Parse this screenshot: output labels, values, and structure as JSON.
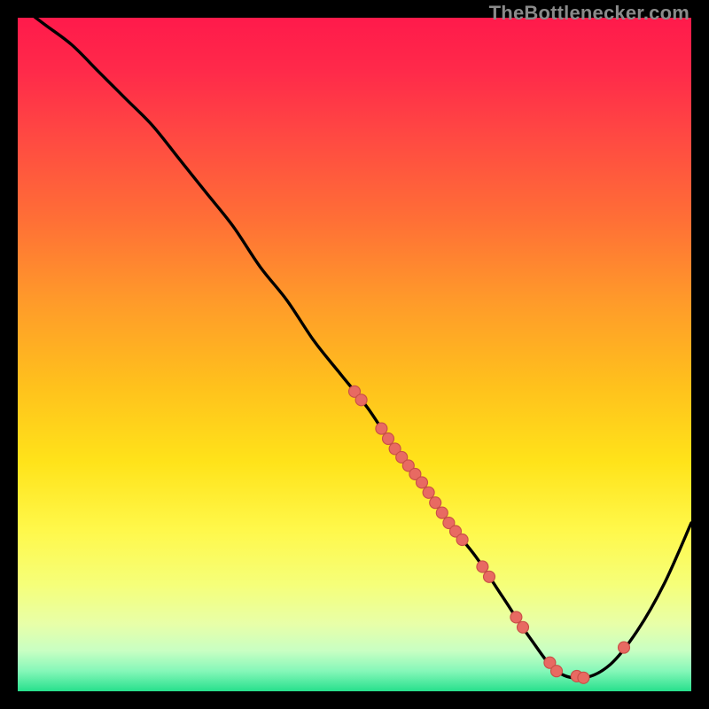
{
  "watermark": "TheBottlenecker.com",
  "gradient_stops": [
    {
      "offset": 0.0,
      "color": "#ff1a4b"
    },
    {
      "offset": 0.08,
      "color": "#ff2a4a"
    },
    {
      "offset": 0.18,
      "color": "#ff4a42"
    },
    {
      "offset": 0.3,
      "color": "#ff6f36"
    },
    {
      "offset": 0.42,
      "color": "#ff9a2a"
    },
    {
      "offset": 0.55,
      "color": "#ffc21c"
    },
    {
      "offset": 0.66,
      "color": "#ffe31a"
    },
    {
      "offset": 0.76,
      "color": "#fff84a"
    },
    {
      "offset": 0.84,
      "color": "#f6ff78"
    },
    {
      "offset": 0.9,
      "color": "#e8ffa8"
    },
    {
      "offset": 0.94,
      "color": "#c8ffc3"
    },
    {
      "offset": 0.97,
      "color": "#85f7b9"
    },
    {
      "offset": 1.0,
      "color": "#27e08c"
    }
  ],
  "curve_color": "#000000",
  "dot_fill": "#e86a62",
  "dot_stroke": "#c94f47",
  "chart_data": {
    "type": "line",
    "title": "",
    "xlabel": "",
    "ylabel": "",
    "xlim": [
      0,
      100
    ],
    "ylim": [
      0,
      100
    ],
    "description": "Bottleneck / fit curve on vertical rainbow gradient (red high → green low). Lower y = better match. Minimum near x≈80.",
    "series": [
      {
        "name": "curve",
        "x": [
          0,
          4,
          8,
          12,
          16,
          20,
          24,
          28,
          32,
          36,
          40,
          44,
          48,
          52,
          56,
          60,
          64,
          68,
          72,
          76,
          80,
          84,
          88,
          92,
          96,
          100
        ],
        "y": [
          102,
          99,
          96,
          92,
          88,
          84,
          79,
          74,
          69,
          63,
          58,
          52,
          47,
          42,
          36,
          31,
          25,
          20,
          14,
          8,
          3,
          2,
          4,
          9,
          16,
          25
        ]
      }
    ],
    "dots_on_curve_x": [
      50,
      51,
      54,
      55,
      56,
      57,
      58,
      59,
      60,
      61,
      62,
      63,
      64,
      65,
      66,
      69,
      70,
      74,
      75,
      79,
      80,
      83,
      84,
      90
    ],
    "dot_radius_px": 6.5
  }
}
